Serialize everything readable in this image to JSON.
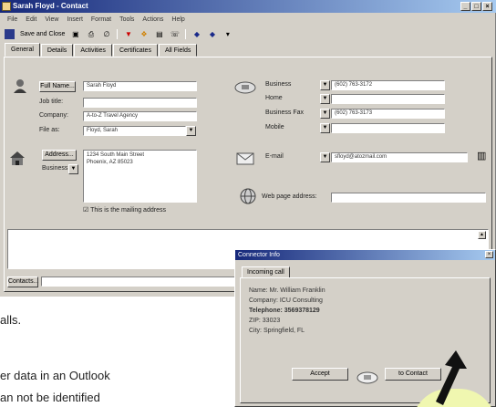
{
  "window": {
    "title": "Sarah Floyd - Contact",
    "controls": [
      "_",
      "□",
      "×"
    ]
  },
  "menu": [
    "File",
    "Edit",
    "View",
    "Insert",
    "Format",
    "Tools",
    "Actions",
    "Help"
  ],
  "toolbar": {
    "save_close_label": "Save and Close"
  },
  "tabs": [
    "General",
    "Details",
    "Activities",
    "Certificates",
    "All Fields"
  ],
  "general": {
    "full_name_button": "Full Name...",
    "full_name_value": "Sarah Floyd",
    "job_title_label": "Job title:",
    "job_title_value": "",
    "company_label": "Company:",
    "company_value": "A-to-Z Travel Agency",
    "file_as_label": "File as:",
    "file_as_value": "Floyd, Sarah",
    "address_button": "Address...",
    "address_type_label": "Business",
    "address_line1": "1234 South Main Street",
    "address_line2": "Phoenix, AZ 85023",
    "mailing_checkbox_label": "This is the mailing address",
    "mailing_checked": true,
    "phones": [
      {
        "label": "Business",
        "value": "(602) 763-3172"
      },
      {
        "label": "Home",
        "value": ""
      },
      {
        "label": "Business Fax",
        "value": "(602) 763-3173"
      },
      {
        "label": "Mobile",
        "value": ""
      }
    ],
    "email_label": "E-mail",
    "email_value": "sfloyd@atozmail.com",
    "webpage_label": "Web page address:",
    "webpage_value": "",
    "contacts_button": "Contacts..."
  },
  "dialog": {
    "title": "Connector Info",
    "tab": "Incoming call",
    "lines": [
      "Name: Mr. William Franklin",
      "Company: ICU Consulting",
      "Telephone: 3569378129",
      "ZIP: 33023",
      "City: Springfield, FL"
    ],
    "accept_button": "Accept",
    "to_contact_button": "to Contact"
  },
  "body_fragments": [
    "alls.",
    "er data in an Outlook",
    "an not be identified"
  ],
  "colors": {
    "titlebar": "#16287a",
    "face": "#d4d0c8",
    "highlight": "#f0f7b0"
  }
}
